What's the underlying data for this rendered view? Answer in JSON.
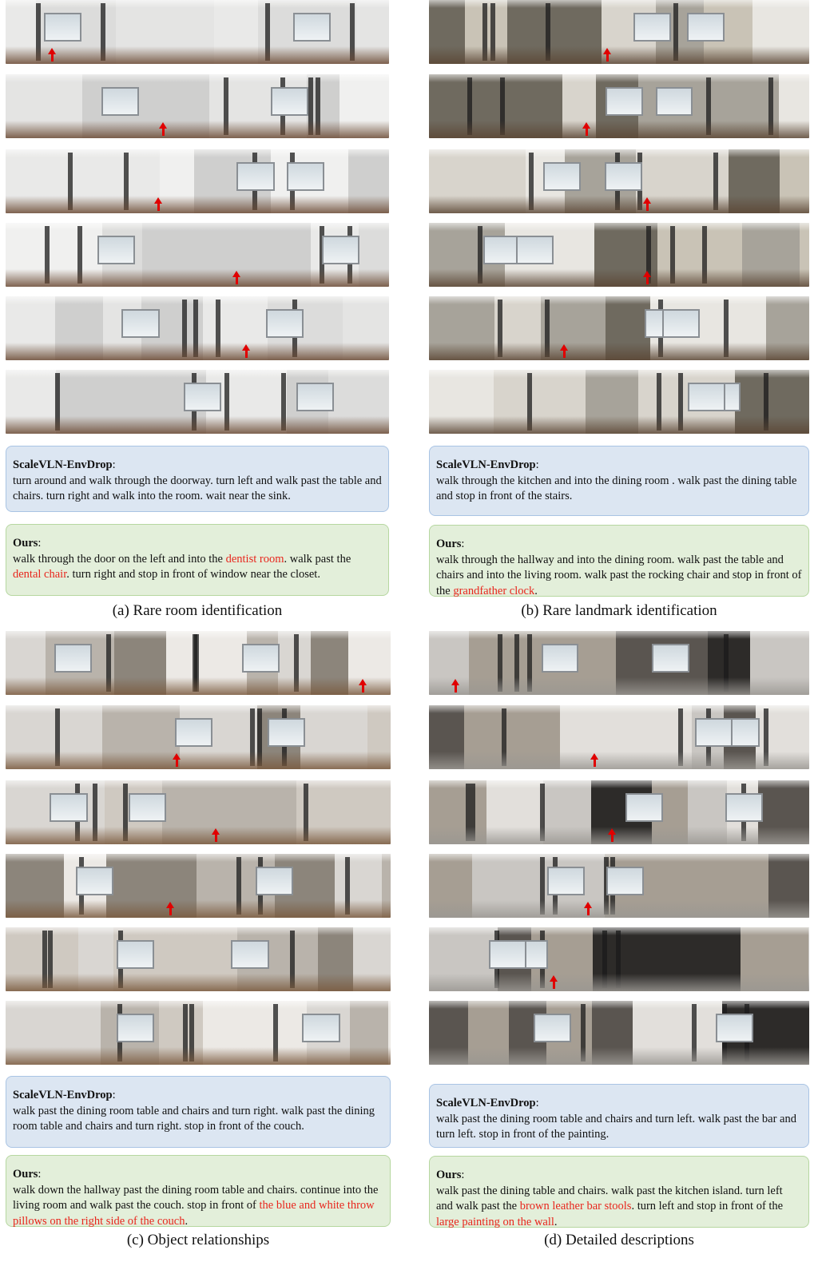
{
  "panels": {
    "a": {
      "caption": "(a) Rare room identification",
      "baseline": {
        "model": "ScaleVLN-EnvDrop",
        "text": "turn around and walk through the doorway. turn left and walk past the table and chairs. turn right and walk into the room. wait near the sink."
      },
      "ours": {
        "model": "Ours",
        "parts": [
          {
            "t": "walk through the door on the left and into the ",
            "hl": false
          },
          {
            "t": "dentist room",
            "hl": true
          },
          {
            "t": ". walk past the ",
            "hl": false
          },
          {
            "t": "dental chair",
            "hl": true
          },
          {
            "t": ". turn right and stop in front of window near the closet.",
            "hl": false
          }
        ]
      }
    },
    "b": {
      "caption": "(b) Rare landmark identification",
      "baseline": {
        "model": "ScaleVLN-EnvDrop",
        "text": "walk through the kitchen and into the dining room . walk past the dining table and stop in front of the stairs."
      },
      "ours": {
        "model": "Ours",
        "parts": [
          {
            "t": "walk through the hallway and into the dining room. walk past the table and chairs and into the living room. walk past the rocking chair and stop in front of the ",
            "hl": false
          },
          {
            "t": "grandfather clock",
            "hl": true
          },
          {
            "t": ".",
            "hl": false
          }
        ]
      }
    },
    "c": {
      "caption": "(c) Object relationships",
      "baseline": {
        "model": "ScaleVLN-EnvDrop",
        "text": "walk past the dining room table and chairs and turn right. walk past the dining room table and chairs and turn right. stop in front of the couch."
      },
      "ours": {
        "model": "Ours",
        "parts": [
          {
            "t": "walk down the hallway past the dining room table and chairs. continue into the living room and walk past the couch. stop in front of ",
            "hl": false
          },
          {
            "t": "the blue and white throw pillows on the right side of the couch",
            "hl": true
          },
          {
            "t": ".",
            "hl": false
          }
        ]
      }
    },
    "d": {
      "caption": "(d) Detailed descriptions",
      "baseline": {
        "model": "ScaleVLN-EnvDrop",
        "text": "walk past the dining room table and chairs and turn left. walk past the bar and turn left. stop in front of the painting."
      },
      "ours": {
        "model": "Ours",
        "parts": [
          {
            "t": "walk past the dining table and chairs. walk past the kitchen island. turn left and walk past the ",
            "hl": false
          },
          {
            "t": "brown leather bar stools",
            "hl": true
          },
          {
            "t": ". turn left and stop in front of the ",
            "hl": false
          },
          {
            "t": "large painting on the wall",
            "hl": true
          },
          {
            "t": ".",
            "hl": false
          }
        ]
      }
    }
  },
  "colors": {
    "highlight": "#e8261d",
    "baseline_bg": "#dce6f2",
    "baseline_border": "#a9c4e4",
    "ours_bg": "#e3efda",
    "ours_border": "#b6d7a0",
    "arrow": "#e00000"
  }
}
